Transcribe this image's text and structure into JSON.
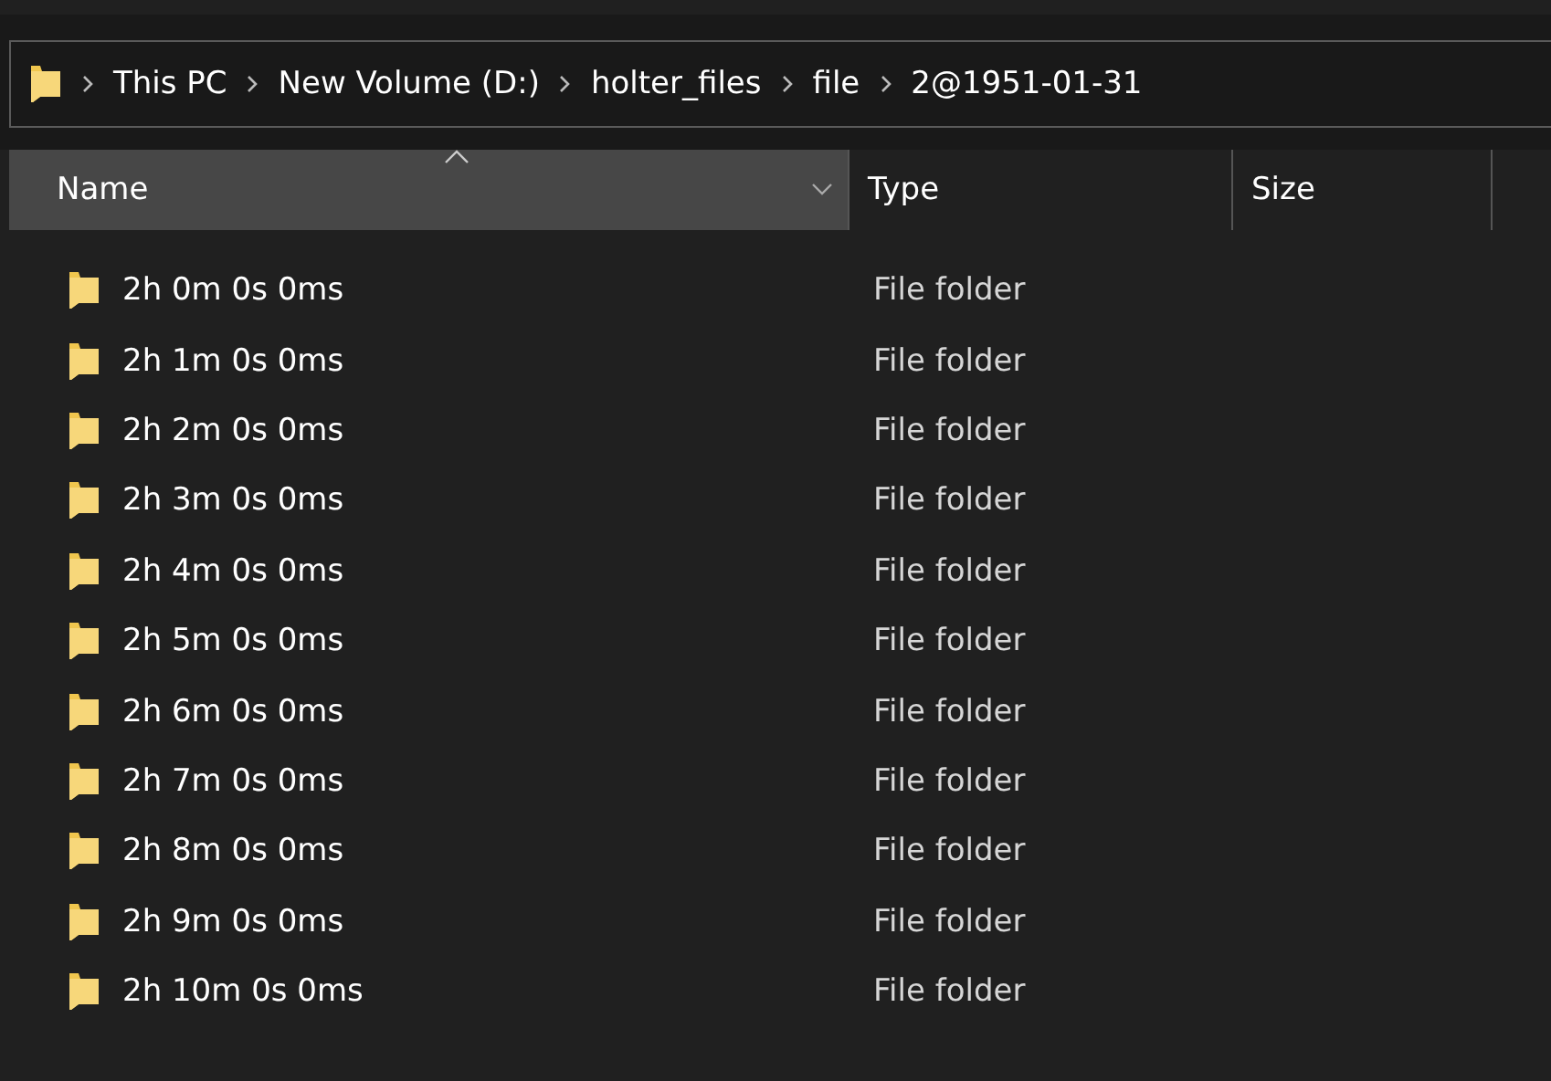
{
  "address_bar": {
    "crumbs": [
      "This PC",
      "New Volume (D:)",
      "holter_files",
      "file",
      "2@1951-01-31"
    ]
  },
  "table": {
    "columns": [
      {
        "label": "Name",
        "selected": true
      },
      {
        "label": "Type",
        "selected": false
      },
      {
        "label": "Size",
        "selected": false
      }
    ],
    "rows": [
      {
        "name": "2h 0m 0s 0ms",
        "type": "File folder"
      },
      {
        "name": "2h 1m 0s 0ms",
        "type": "File folder"
      },
      {
        "name": "2h 2m 0s 0ms",
        "type": "File folder"
      },
      {
        "name": "2h 3m 0s 0ms",
        "type": "File folder"
      },
      {
        "name": "2h 4m 0s 0ms",
        "type": "File folder"
      },
      {
        "name": "2h 5m 0s 0ms",
        "type": "File folder"
      },
      {
        "name": "2h 6m 0s 0ms",
        "type": "File folder"
      },
      {
        "name": "2h 7m 0s 0ms",
        "type": "File folder"
      },
      {
        "name": "2h 8m 0s 0ms",
        "type": "File folder"
      },
      {
        "name": "2h 9m 0s 0ms",
        "type": "File folder"
      },
      {
        "name": "2h 10m 0s 0ms",
        "type": "File folder"
      }
    ]
  }
}
